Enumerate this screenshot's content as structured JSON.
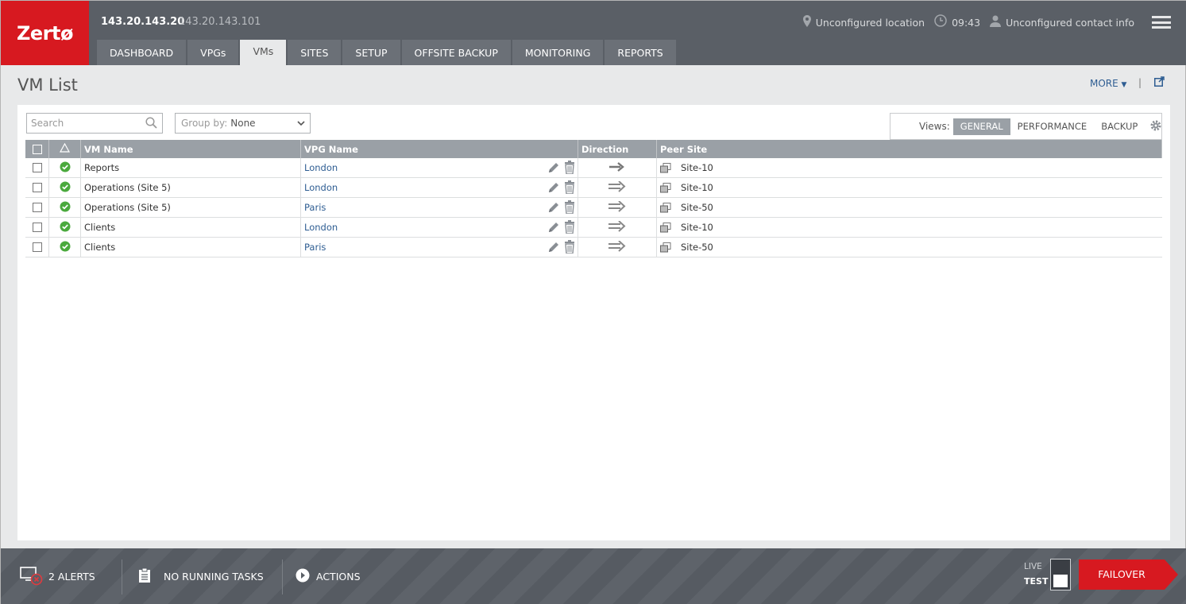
{
  "app": {
    "logo_text": "Zertø",
    "ip_primary": "143.20.143.20",
    "ip_secondary": "143.20.143.101"
  },
  "header_info": {
    "location": "Unconfigured location",
    "time": "09:43",
    "contact": "Unconfigured contact info"
  },
  "tabs": [
    {
      "label": "DASHBOARD",
      "active": false
    },
    {
      "label": "VPGs",
      "active": false
    },
    {
      "label": "VMs",
      "active": true
    },
    {
      "label": "SITES",
      "active": false
    },
    {
      "label": "SETUP",
      "active": false
    },
    {
      "label": "OFFSITE BACKUP",
      "active": false
    },
    {
      "label": "MONITORING",
      "active": false
    },
    {
      "label": "REPORTS",
      "active": false
    }
  ],
  "page": {
    "title": "VM List",
    "more_label": "MORE",
    "divider": "|"
  },
  "toolbar": {
    "search_placeholder": "Search",
    "groupby_label": "Group by:",
    "groupby_value": "None",
    "views_label": "Views:",
    "views": [
      "GENERAL",
      "PERFORMANCE",
      "BACKUP"
    ],
    "selected_view": "GENERAL"
  },
  "table": {
    "columns": [
      "VM Name",
      "VPG Name",
      "Direction",
      "Peer Site"
    ],
    "rows": [
      {
        "vm": "Reports",
        "vpg": "London",
        "direction": "one-way",
        "peer": "Site-10"
      },
      {
        "vm": "Operations (Site 5)",
        "vpg": "London",
        "direction": "two-way",
        "peer": "Site-10"
      },
      {
        "vm": "Operations (Site 5)",
        "vpg": "Paris",
        "direction": "two-way",
        "peer": "Site-50"
      },
      {
        "vm": "Clients",
        "vpg": "London",
        "direction": "two-way",
        "peer": "Site-10"
      },
      {
        "vm": "Clients",
        "vpg": "Paris",
        "direction": "two-way",
        "peer": "Site-50"
      }
    ]
  },
  "footer": {
    "alerts": "2 ALERTS",
    "tasks": "NO RUNNING TASKS",
    "actions": "ACTIONS",
    "live_label": "LIVE",
    "test_label": "TEST",
    "failover_label": "FAILOVER"
  },
  "colors": {
    "brand_red": "#d71920",
    "header_bg": "#5a5f66",
    "status_ok": "#4aa93d",
    "link": "#2e5d92"
  }
}
